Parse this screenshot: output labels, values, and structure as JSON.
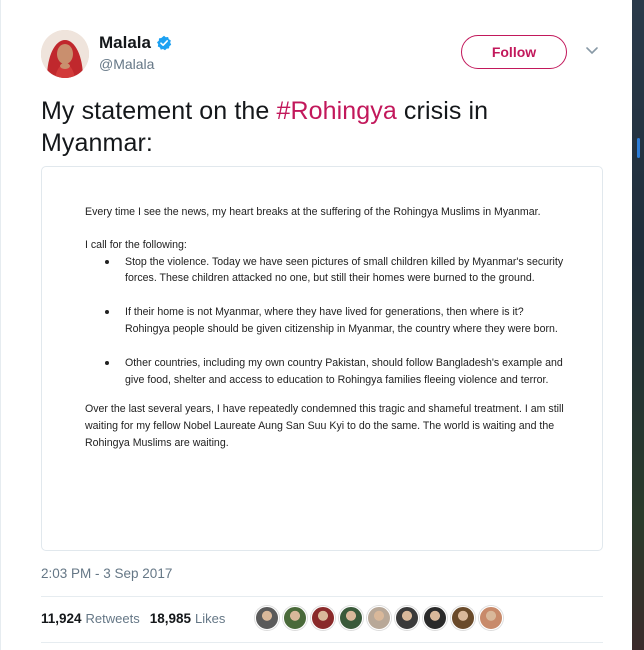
{
  "user": {
    "name": "Malala",
    "handle": "@Malala"
  },
  "follow_label": "Follow",
  "tweet": {
    "text_before": "My statement on the ",
    "hashtag": "#Rohingya",
    "text_after": " crisis in Myanmar:"
  },
  "statement": {
    "intro": "Every time I see the news, my heart breaks at the suffering of the Rohingya Muslims in Myanmar.",
    "call": "I call for the following:",
    "points": [
      "Stop the violence. Today we have seen pictures of small children killed by Myanmar's security forces. These children attacked no one, but still their homes were burned to the ground.",
      "If their home is not Myanmar, where they have lived for generations, then where is it? Rohingya people should be given citizenship in Myanmar, the country where they were born.",
      "Other countries, including my own country Pakistan, should follow Bangladesh's example and give food, shelter and access to education to Rohingya families fleeing violence and terror."
    ],
    "closing": "Over the last several years, I have repeatedly condemned this tragic and shameful treatment. I am still waiting for my fellow Nobel Laureate Aung San Suu Kyi to do the same. The world is waiting and the Rohingya Muslims are waiting."
  },
  "timestamp": "2:03 PM - 3 Sep 2017",
  "stats": {
    "retweets_count": "11,924",
    "retweets_label": "Retweets",
    "likes_count": "18,985",
    "likes_label": "Likes"
  },
  "colors": {
    "accent": "#c2185b",
    "verified": "#1da1f2",
    "muted": "#657786"
  },
  "icons": {
    "verified": "verified-badge-icon",
    "chevron": "chevron-down-icon"
  },
  "liker_avatar_colors": [
    "#5a5a5a",
    "#4a6a3a",
    "#8a2a2a",
    "#3a5a3a",
    "#b8a898",
    "#3a3a3a",
    "#2a2a2a",
    "#6a4a2a",
    "#c88a6a"
  ]
}
